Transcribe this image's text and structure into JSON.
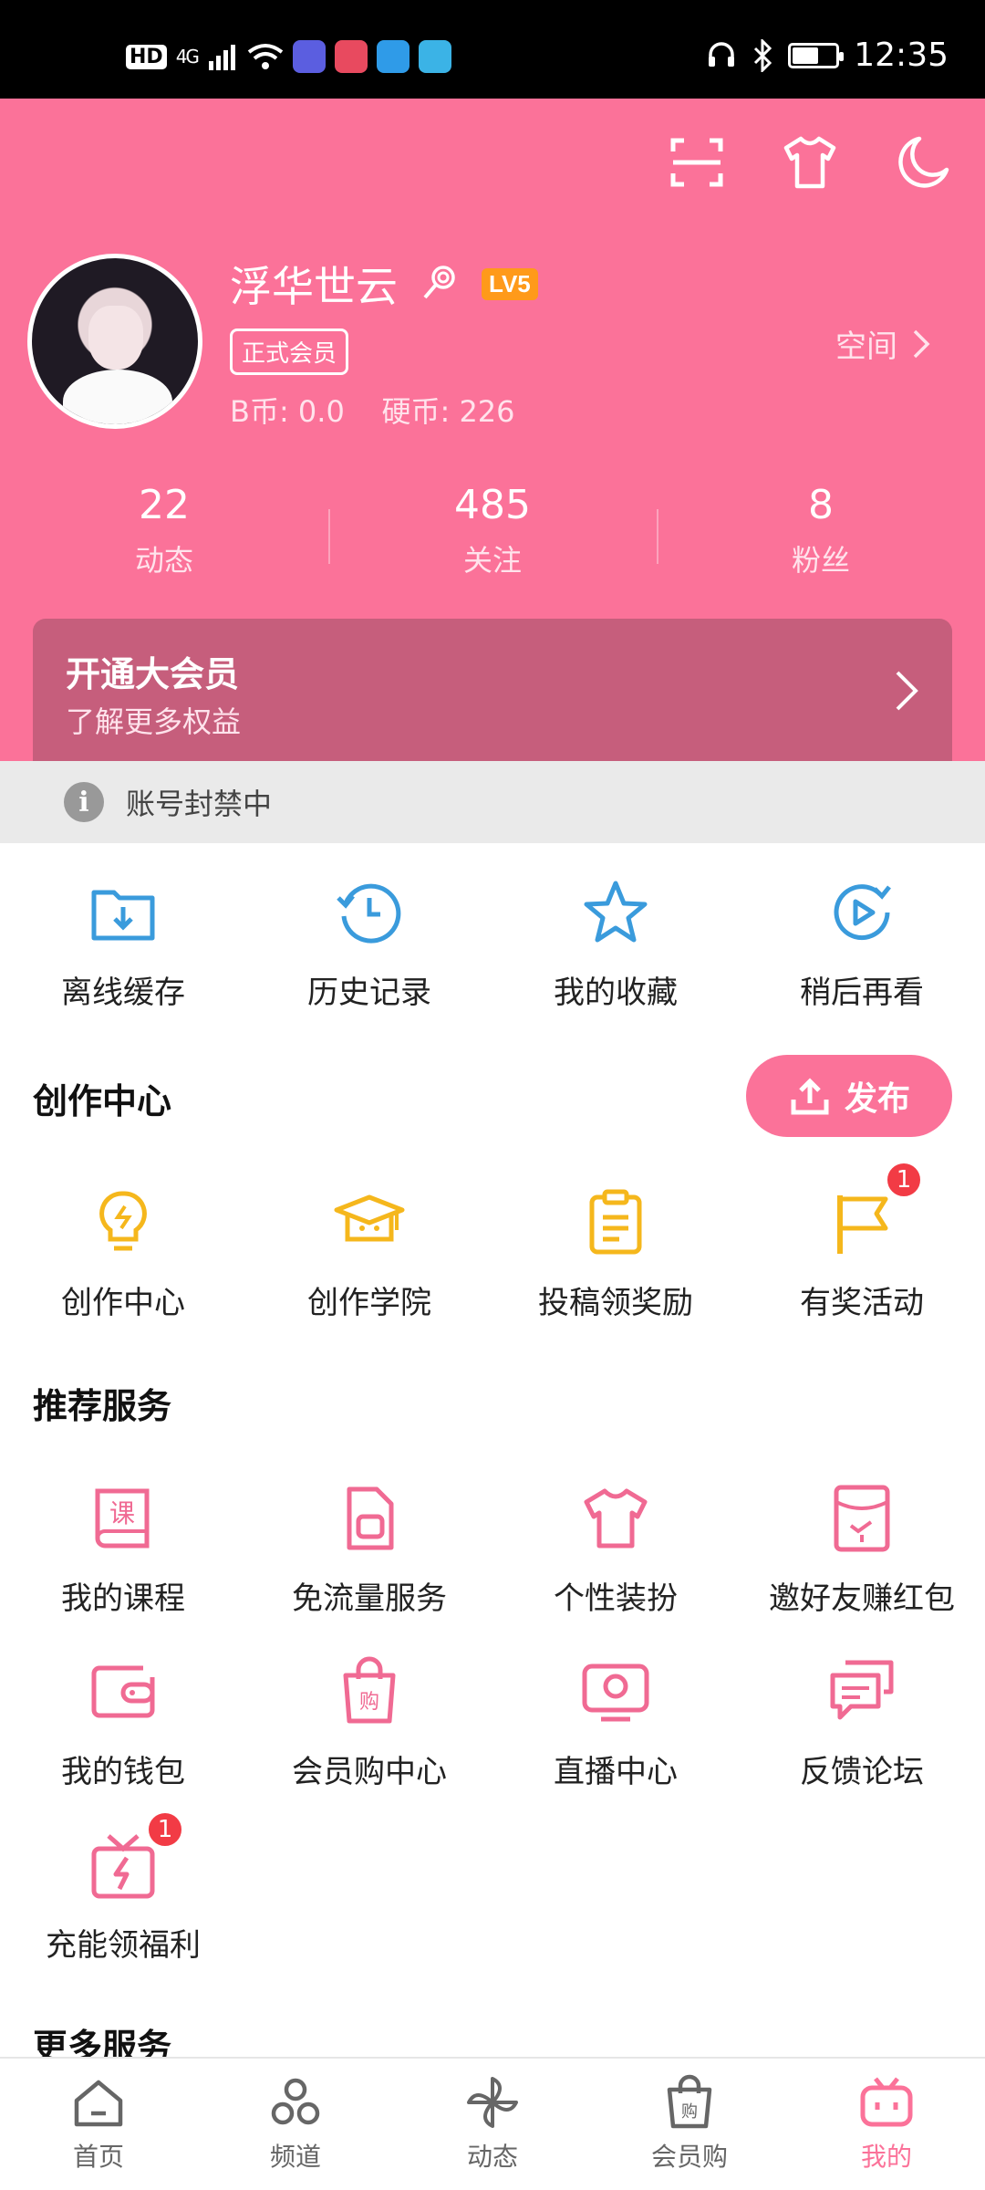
{
  "status_bar": {
    "hd": "HD",
    "network": "4G",
    "time": "12:35"
  },
  "header": {
    "username": "浮华世云",
    "level": "LV5",
    "vip_tag": "正式会员",
    "coins": "B币: 0.0    硬币: 226",
    "space_link": "空间",
    "stats": [
      {
        "value": "22",
        "label": "动态"
      },
      {
        "value": "485",
        "label": "关注"
      },
      {
        "value": "8",
        "label": "粉丝"
      }
    ],
    "vip_banner": {
      "title": "开通大会员",
      "subtitle": "了解更多权益"
    }
  },
  "notice": {
    "text": "账号封禁中"
  },
  "quick_actions": [
    {
      "label": "离线缓存",
      "icon": "download-folder-icon"
    },
    {
      "label": "历史记录",
      "icon": "history-clock-icon"
    },
    {
      "label": "我的收藏",
      "icon": "star-icon"
    },
    {
      "label": "稍后再看",
      "icon": "watch-later-icon"
    }
  ],
  "creation": {
    "title": "创作中心",
    "publish_label": "发布",
    "items": [
      {
        "label": "创作中心",
        "icon": "lightbulb-icon",
        "badge": ""
      },
      {
        "label": "创作学院",
        "icon": "graduation-cap-icon",
        "badge": ""
      },
      {
        "label": "投稿领奖励",
        "icon": "clipboard-icon",
        "badge": ""
      },
      {
        "label": "有奖活动",
        "icon": "flag-icon",
        "badge": "1"
      }
    ]
  },
  "services": {
    "title": "推荐服务",
    "items": [
      {
        "label": "我的课程",
        "icon": "course-book-icon"
      },
      {
        "label": "免流量服务",
        "icon": "sim-card-icon"
      },
      {
        "label": "个性装扮",
        "icon": "tshirt-icon"
      },
      {
        "label": "邀好友赚红包",
        "icon": "red-envelope-icon"
      },
      {
        "label": "我的钱包",
        "icon": "wallet-icon"
      },
      {
        "label": "会员购中心",
        "icon": "shopping-bag-icon"
      },
      {
        "label": "直播中心",
        "icon": "live-tv-icon"
      },
      {
        "label": "反馈论坛",
        "icon": "chat-bubbles-icon"
      },
      {
        "label": "充能领福利",
        "icon": "gift-bolt-icon",
        "badge": "1"
      }
    ]
  },
  "more_services": {
    "title": "更多服务"
  },
  "bottom_nav": [
    {
      "label": "首页",
      "icon": "home-icon"
    },
    {
      "label": "频道",
      "icon": "channel-icon"
    },
    {
      "label": "动态",
      "icon": "pinwheel-icon"
    },
    {
      "label": "会员购",
      "icon": "shopping-bag-icon"
    },
    {
      "label": "我的",
      "icon": "tv-icon",
      "active": true
    }
  ],
  "colors": {
    "brand_pink": "#fb7299",
    "icon_blue": "#3a9bdc",
    "icon_yellow": "#f5b71c",
    "icon_pink": "#f06a93",
    "badge_red": "#f23b45"
  }
}
